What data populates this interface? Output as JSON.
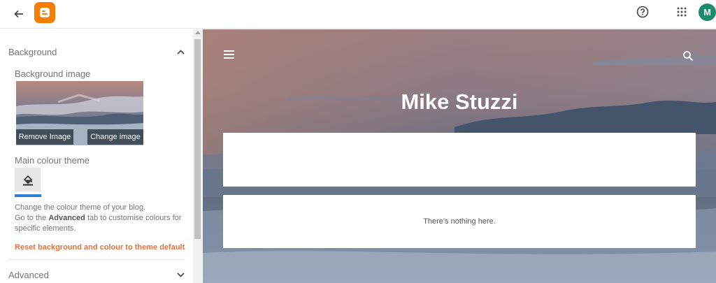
{
  "header": {
    "avatar_initial": "M",
    "brand_color": "#f57d00",
    "avatar_color": "#1e8a6a"
  },
  "sidebar": {
    "background_section": {
      "title": "Background",
      "expanded": true
    },
    "background_image_label": "Background image",
    "remove_image_label": "Remove Image",
    "change_image_label": "Change image",
    "main_colour_theme_label": "Main colour theme",
    "description_line1": "Change the colour theme of your blog.",
    "description_prefix": "Go to the ",
    "description_bold": "Advanced",
    "description_suffix": " tab to customise colours for specific elements.",
    "reset_label": "Reset background and colour to theme default",
    "advanced_section": {
      "title": "Advanced",
      "expanded": false
    },
    "accent_color": "#e8703a",
    "swatch_color": "#2f7fd6"
  },
  "preview": {
    "blog_title": "Mike Stuzzi",
    "empty_message": "There's nothing here."
  }
}
